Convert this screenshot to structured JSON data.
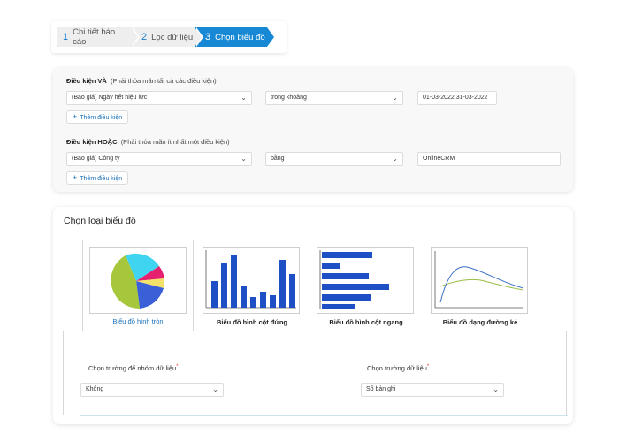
{
  "stepper": {
    "steps": [
      {
        "num": "1",
        "label": "Chi tiết báo cáo"
      },
      {
        "num": "2",
        "label": "Lọc dữ liệu"
      },
      {
        "num": "3",
        "label": "Chọn biểu đồ"
      }
    ],
    "active_index": 2,
    "active_color": "#1789d4"
  },
  "conditions": {
    "and_group": {
      "title": "Điều kiện VÀ",
      "hint": "(Phải thỏa mãn tất cả các điều kiện)",
      "field": "(Báo giá) Ngày hết hiệu lực",
      "operator": "trong khoảng",
      "value": "01-03-2022,31-03-2022",
      "add_label": "Thêm điều kiện"
    },
    "or_group": {
      "title": "Điều kiện HOẶC",
      "hint": "(Phải thỏa mãn ít nhất một điều kiện)",
      "field": "(Báo giá) Công ty",
      "operator": "bằng",
      "value": "OnlineCRM",
      "add_label": "Thêm điều kiện"
    }
  },
  "chart_picker": {
    "title": "Chọn loại biểu đồ",
    "types": [
      {
        "label": "Biểu đồ hình tròn",
        "icon": "pie-chart-icon",
        "selected": true
      },
      {
        "label": "Biểu đồ hình cột đứng",
        "icon": "vertical-bar-chart-icon",
        "selected": false
      },
      {
        "label": "Biểu đồ hình cột ngang",
        "icon": "horizontal-bar-chart-icon",
        "selected": false
      },
      {
        "label": "Biểu đồ dạng đường kẻ",
        "icon": "line-chart-icon",
        "selected": false
      }
    ],
    "group_field": {
      "label": "Chọn trường để nhóm dữ liệu",
      "required_mark": "*",
      "value": "Không"
    },
    "data_field": {
      "label": "Chọn trường dữ liệu",
      "required_mark": "*",
      "value": "Số bản ghi"
    }
  },
  "colors": {
    "link_blue": "#1a6fb8",
    "bar_blue": "#1f4fc4",
    "pie_cyan": "#3fd4ef",
    "pie_green": "#a6c63c",
    "pie_magenta": "#e5216f",
    "pie_blue": "#3b5fd6",
    "pie_yellow": "#f2e26a"
  }
}
